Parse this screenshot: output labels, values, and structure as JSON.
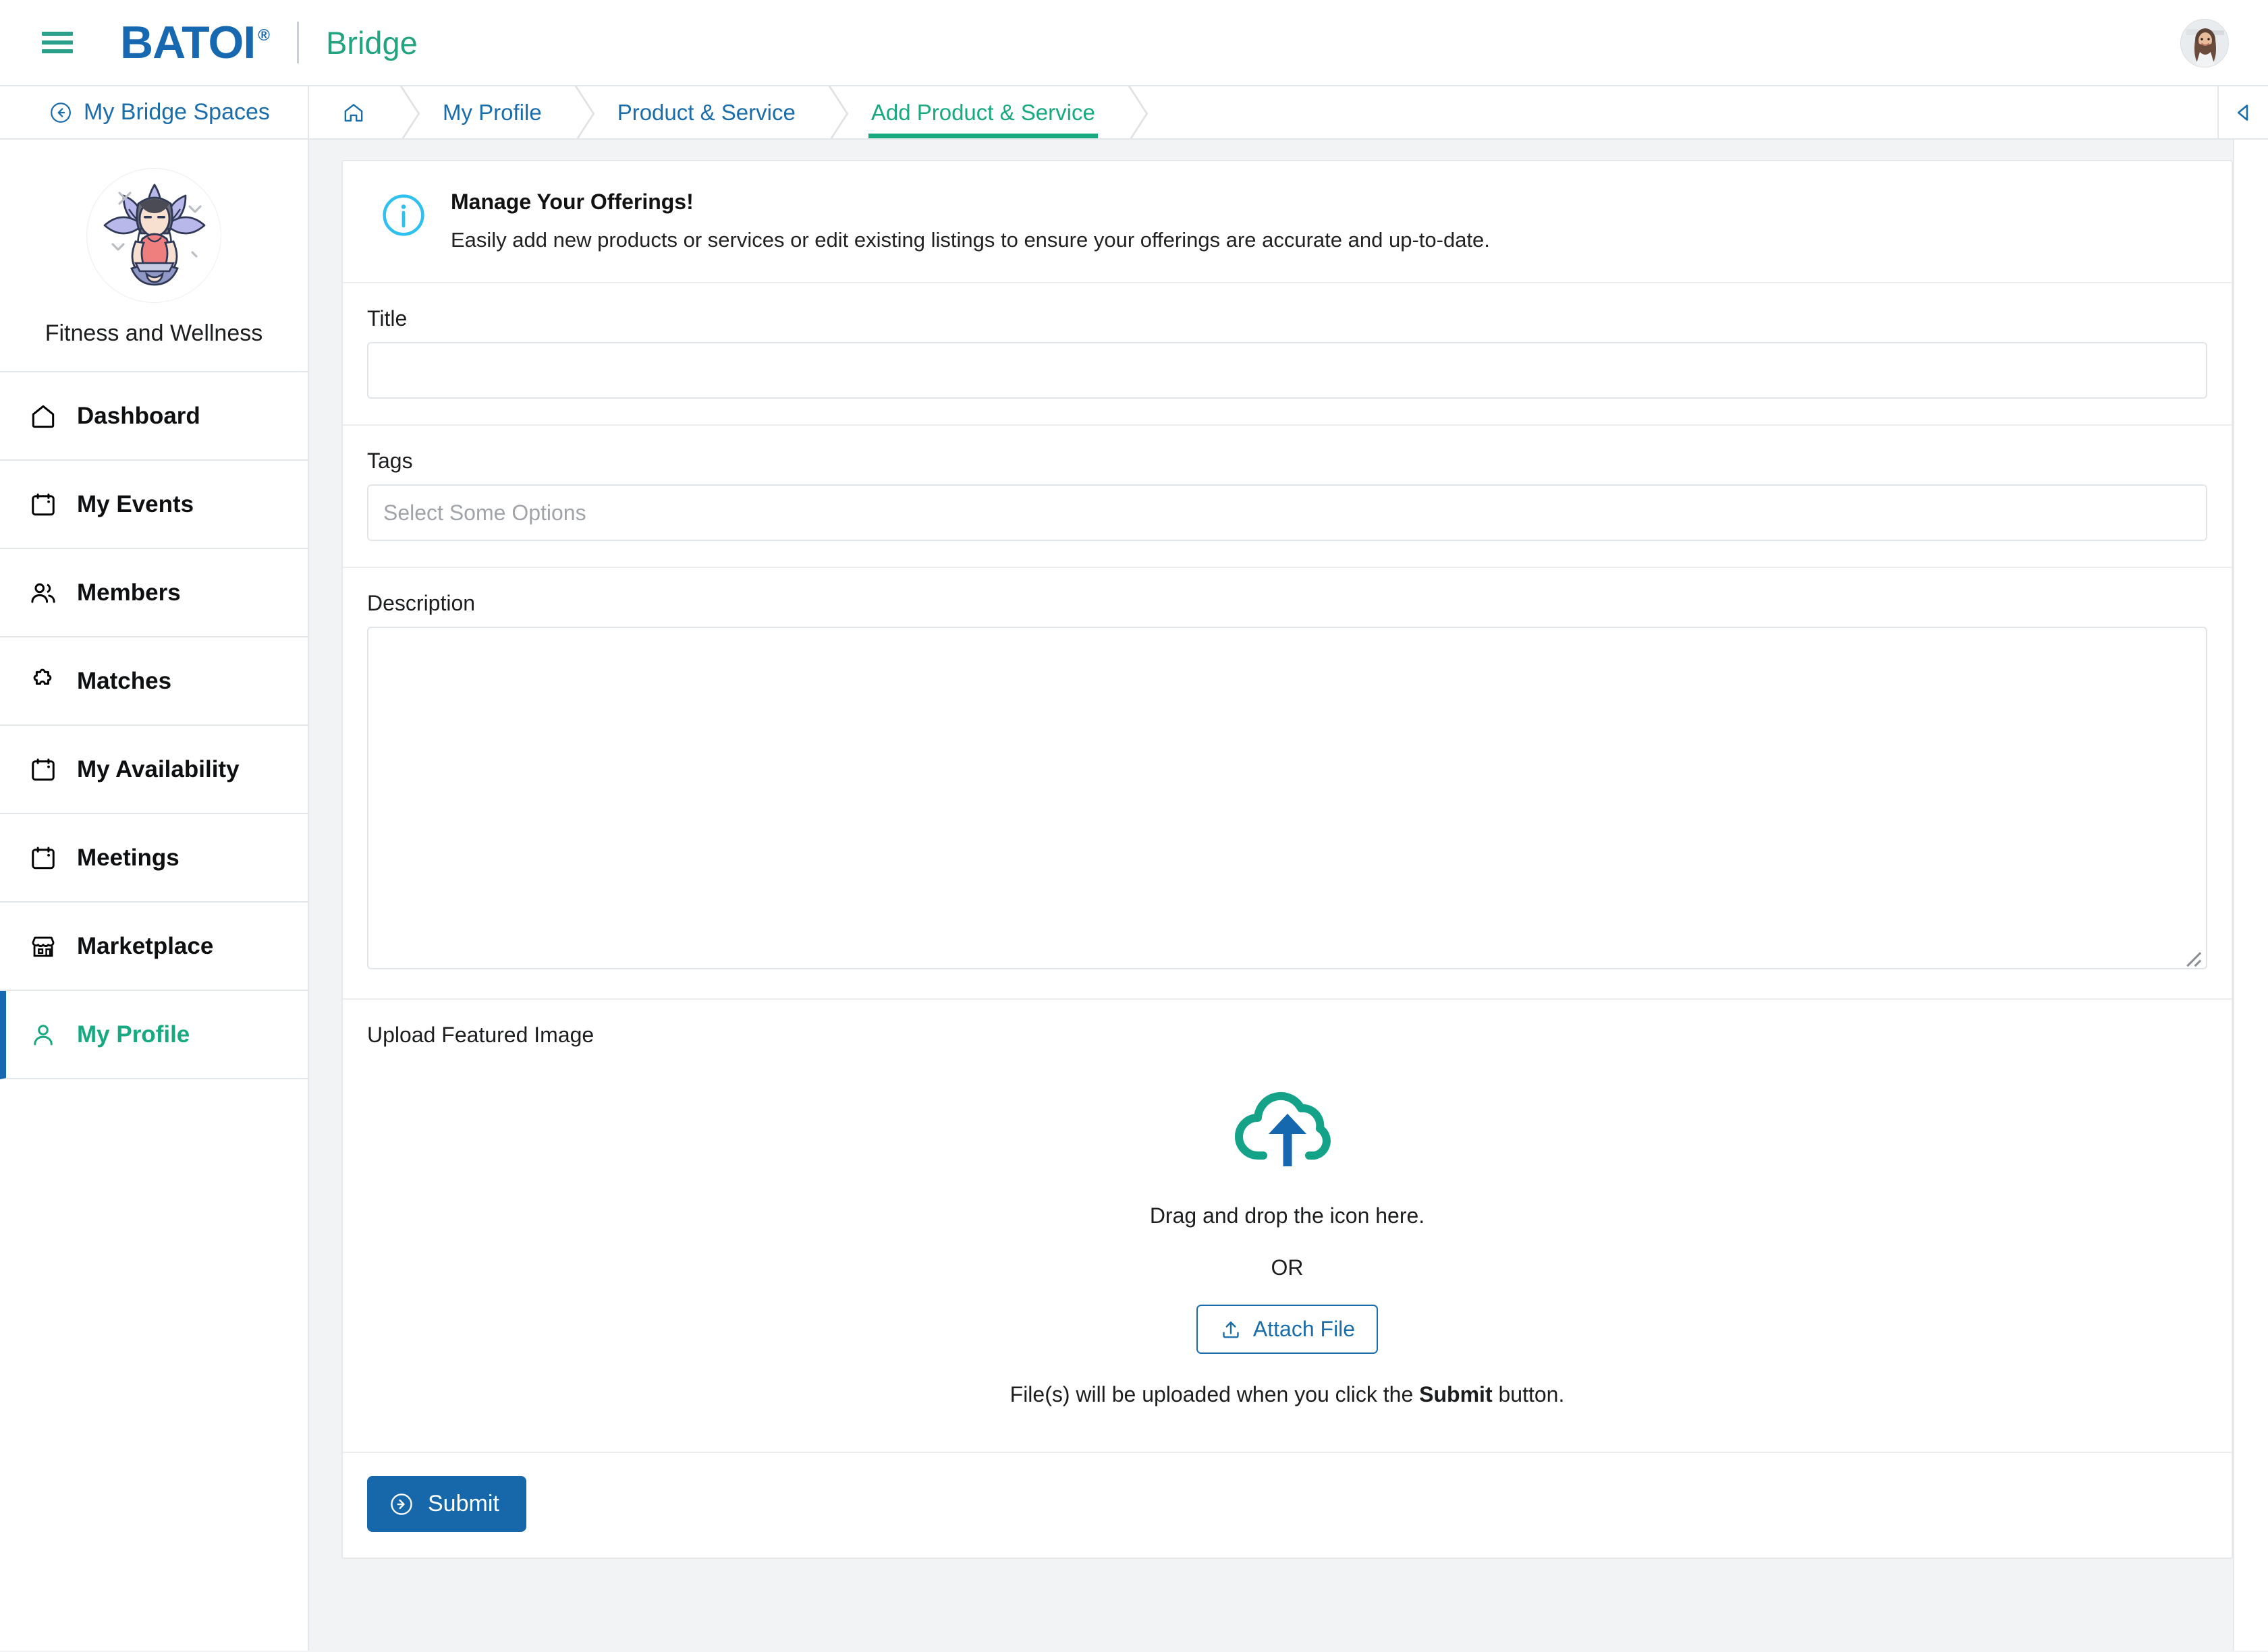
{
  "topbar": {
    "menu_icon": "hamburger-icon",
    "logo_text": "BATOI",
    "logo_registered": "®",
    "product_label": "Bridge",
    "avatar_icon": "user-avatar"
  },
  "sidebar": {
    "back_label": "My Bridge Spaces",
    "back_icon": "arrow-left-circle-icon",
    "space_name": "Fitness and Wellness",
    "space_avatar_icon": "yoga-lotus-avatar",
    "items": [
      {
        "label": "Dashboard",
        "icon": "home-icon",
        "active": false
      },
      {
        "label": "My Events",
        "icon": "calendar-icon",
        "active": false
      },
      {
        "label": "Members",
        "icon": "users-icon",
        "active": false
      },
      {
        "label": "Matches",
        "icon": "puzzle-icon",
        "active": false
      },
      {
        "label": "My Availability",
        "icon": "calendar-icon",
        "active": false
      },
      {
        "label": "Meetings",
        "icon": "calendar-icon",
        "active": false
      },
      {
        "label": "Marketplace",
        "icon": "storefront-icon",
        "active": false
      },
      {
        "label": "My Profile",
        "icon": "person-icon",
        "active": true
      }
    ]
  },
  "breadcrumb": {
    "home_icon": "home-icon",
    "items": [
      {
        "label": "My Profile",
        "active": false
      },
      {
        "label": "Product & Service",
        "active": false
      },
      {
        "label": "Add Product & Service",
        "active": true
      }
    ],
    "collapse_icon": "chevron-left-icon"
  },
  "banner": {
    "icon": "info-circle-icon",
    "title": "Manage Your Offerings!",
    "description": "Easily add new products or services or edit existing listings to ensure your offerings are accurate and up-to-date."
  },
  "form": {
    "title": {
      "label": "Title",
      "value": "",
      "placeholder": ""
    },
    "tags": {
      "label": "Tags",
      "value": "",
      "placeholder": "Select Some Options"
    },
    "description": {
      "label": "Description",
      "value": "",
      "placeholder": ""
    },
    "upload": {
      "label": "Upload Featured Image",
      "cloud_icon": "cloud-upload-icon",
      "drag_text": "Drag and drop the icon here.",
      "or_text": "OR",
      "attach_label": "Attach File",
      "attach_icon": "upload-icon",
      "note_prefix": "File(s) will be uploaded when you click the ",
      "note_bold": "Submit",
      "note_suffix": " button."
    },
    "submit": {
      "label": "Submit",
      "icon": "arrow-right-circle-icon"
    }
  },
  "colors": {
    "brand_blue": "#1668b0",
    "brand_teal": "#21a47f",
    "accent_active": "#17a97f",
    "link_blue": "#1a6daa",
    "info_cyan": "#2ec0ee",
    "submit_blue": "#1668ab"
  }
}
